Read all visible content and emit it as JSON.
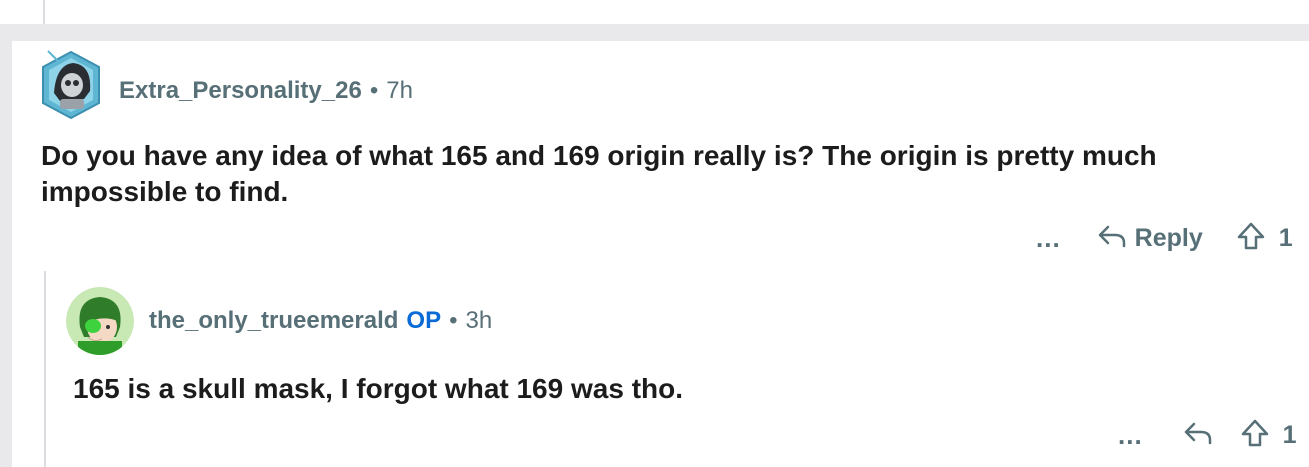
{
  "top_comment": {
    "username": "Extra_Personality_26",
    "time": "7h",
    "body": "Do you have any idea of what 165 and 169 origin really is? The origin is pretty much impossible to find.",
    "more": "...",
    "reply_label": "Reply",
    "vote_count": "1"
  },
  "reply_comment": {
    "username": "the_only_trueemerald",
    "op_badge": "OP",
    "time": "3h",
    "body": "165 is a skull mask, I forgot what 169 was tho.",
    "more": "...",
    "vote_count": "1"
  },
  "separator": "•",
  "colors": {
    "meta_text": "#576f76",
    "op_badge": "#0a6bd6",
    "body_text": "#1c1c1c",
    "background": "#e9e9ec"
  }
}
